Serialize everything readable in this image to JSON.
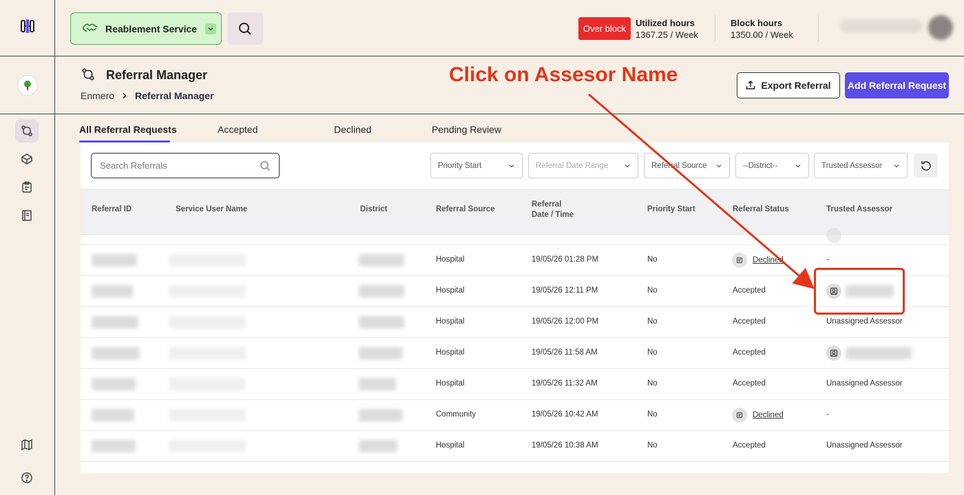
{
  "header": {
    "service_label": "Reablement Service",
    "overblock_label": "Over block",
    "utilized_title": "Utilized hours",
    "utilized_value": "1367.25 / Week",
    "block_title": "Block hours",
    "block_value": "1350.00 / Week"
  },
  "page": {
    "title": "Referral Manager",
    "breadcrumb_root": "Enmero",
    "breadcrumb_current": "Referral Manager",
    "export_label": "Export Referral",
    "add_label": "Add Referral Request"
  },
  "annotation": {
    "text": "Click on Assesor Name"
  },
  "tabs": [
    {
      "label": "All Referral Requests",
      "active": true
    },
    {
      "label": "Accepted",
      "active": false
    },
    {
      "label": "Declined",
      "active": false
    },
    {
      "label": "Pending Review",
      "active": false
    }
  ],
  "search": {
    "placeholder": "Search Referrals"
  },
  "filters": [
    {
      "label": "Priority Start"
    },
    {
      "label": "Referral Date Range"
    },
    {
      "label": "Referral Source"
    },
    {
      "label": "--District--"
    },
    {
      "label": "Trusted Assessor"
    }
  ],
  "table": {
    "columns": [
      "Referral ID",
      "Service User Name",
      "District",
      "Referral Source",
      "Referral",
      "Date / Time",
      "Priority Start",
      "Referral Status",
      "Trusted Assessor"
    ],
    "rows": [
      {
        "source": "Hospital",
        "datetime": "19/05/26 01:28 PM",
        "priority": "No",
        "status": "Declined",
        "assessor": "-"
      },
      {
        "source": "Hospital",
        "datetime": "19/05/26 12:11 PM",
        "priority": "No",
        "status": "Accepted",
        "assessor": ""
      },
      {
        "source": "Hospital",
        "datetime": "19/05/26 12:00 PM",
        "priority": "No",
        "status": "Accepted",
        "assessor": "Unassigned Assessor"
      },
      {
        "source": "Hospital",
        "datetime": "19/05/26 11:58 AM",
        "priority": "No",
        "status": "Accepted",
        "assessor": ""
      },
      {
        "source": "Hospital",
        "datetime": "19/05/26 11:32 AM",
        "priority": "No",
        "status": "Accepted",
        "assessor": "Unassigned Assessor"
      },
      {
        "source": "Community",
        "datetime": "19/05/26 10:42 AM",
        "priority": "No",
        "status": "Declined",
        "assessor": "-"
      },
      {
        "source": "Hospital",
        "datetime": "19/05/26 10:38 AM",
        "priority": "No",
        "status": "Accepted",
        "assessor": "Unassigned Assessor"
      }
    ]
  },
  "colors": {
    "accent": "#5b4ee6",
    "annotation": "#e2361b",
    "overblock": "#ea2b2b",
    "service_bg": "#d6f5cf"
  }
}
